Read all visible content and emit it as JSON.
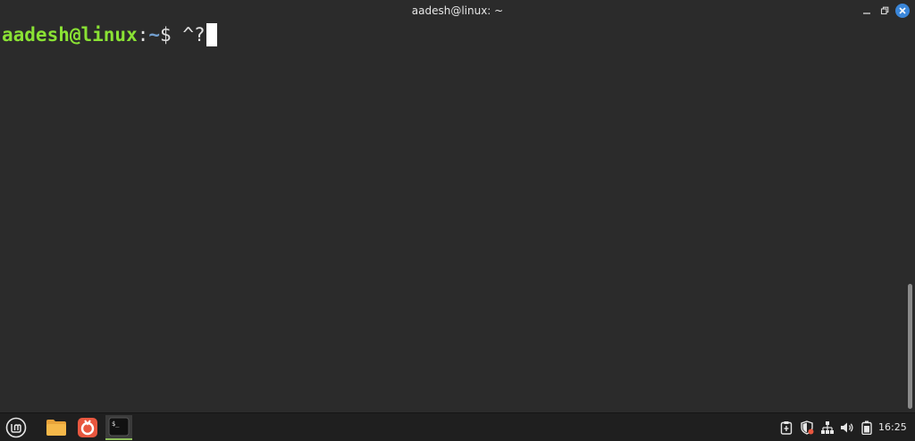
{
  "window": {
    "title": "aadesh@linux: ~",
    "controls": {
      "minimize": "minimize-icon",
      "maximize": "restore-icon",
      "close": "close-icon"
    }
  },
  "terminal": {
    "prompt_user": "aadesh@linux",
    "prompt_colon": ":",
    "prompt_path": "~",
    "prompt_symbol": "$",
    "input": " ^?",
    "colors": {
      "background": "#2b2b2b",
      "user": "#8ae234",
      "path": "#729fcf",
      "text": "#e0e0e0"
    }
  },
  "taskbar": {
    "items": [
      {
        "name": "mint-menu-icon"
      },
      {
        "name": "files-icon"
      },
      {
        "name": "software-manager-icon"
      },
      {
        "name": "terminal-icon",
        "label": "$_"
      }
    ],
    "tray": [
      {
        "name": "clipboard-icon"
      },
      {
        "name": "shield-icon"
      },
      {
        "name": "network-icon"
      },
      {
        "name": "volume-icon"
      },
      {
        "name": "battery-icon"
      }
    ],
    "clock": "16:25"
  }
}
